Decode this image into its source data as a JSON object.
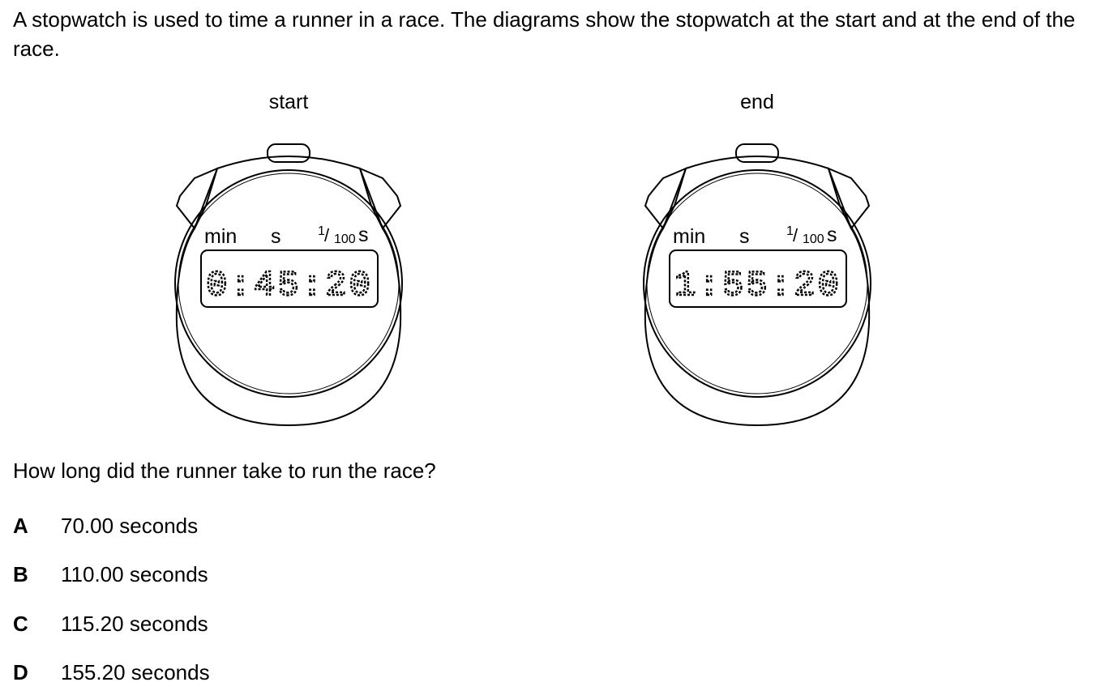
{
  "intro": "A stopwatch is used to time a runner in a race. The diagrams show the stopwatch at the start and at the end of the race.",
  "stopwatches": [
    {
      "caption": "start",
      "display": "0:45:20",
      "unit_min": "min",
      "unit_s": "s",
      "unit_hundredths_num": "1",
      "unit_hundredths_den": "100",
      "unit_hundredths_s": "s"
    },
    {
      "caption": "end",
      "display": "1:55:20",
      "unit_min": "min",
      "unit_s": "s",
      "unit_hundredths_num": "1",
      "unit_hundredths_den": "100",
      "unit_hundredths_s": "s"
    }
  ],
  "question": "How long did the runner take to run the race?",
  "options": [
    {
      "letter": "A",
      "text": "70.00 seconds"
    },
    {
      "letter": "B",
      "text": "110.00 seconds"
    },
    {
      "letter": "C",
      "text": "115.20 seconds"
    },
    {
      "letter": "D",
      "text": "155.20 seconds"
    }
  ]
}
